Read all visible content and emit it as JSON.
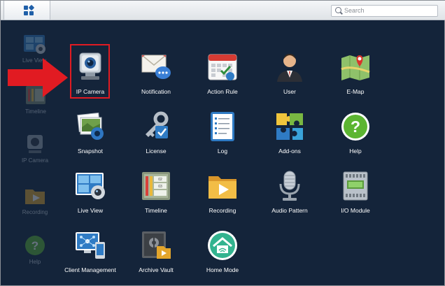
{
  "topbar": {
    "menu_icon": "grid-icon",
    "search": {
      "placeholder": "Search",
      "icon": "search-icon"
    }
  },
  "desktop": {
    "items": [
      {
        "label": "Live View",
        "icon": "live-view-icon"
      },
      {
        "label": "Timeline",
        "icon": "timeline-icon"
      },
      {
        "label": "IP Camera",
        "icon": "ip-camera-icon"
      },
      {
        "label": "Recording",
        "icon": "recording-icon"
      },
      {
        "label": "Help",
        "icon": "help-icon"
      }
    ]
  },
  "apps": [
    {
      "label": "IP Camera",
      "icon": "ip-camera-icon"
    },
    {
      "label": "Notification",
      "icon": "notification-icon"
    },
    {
      "label": "Action Rule",
      "icon": "action-rule-icon"
    },
    {
      "label": "User",
      "icon": "user-icon"
    },
    {
      "label": "E-Map",
      "icon": "e-map-icon"
    },
    {
      "label": "Snapshot",
      "icon": "snapshot-icon"
    },
    {
      "label": "License",
      "icon": "license-icon"
    },
    {
      "label": "Log",
      "icon": "log-icon"
    },
    {
      "label": "Add-ons",
      "icon": "add-ons-icon"
    },
    {
      "label": "Help",
      "icon": "help-icon"
    },
    {
      "label": "Live View",
      "icon": "live-view-icon"
    },
    {
      "label": "Timeline",
      "icon": "timeline-icon"
    },
    {
      "label": "Recording",
      "icon": "recording-icon"
    },
    {
      "label": "Audio Pattern",
      "icon": "audio-pattern-icon"
    },
    {
      "label": "I/O Module",
      "icon": "io-module-icon"
    },
    {
      "label": "Client Management",
      "icon": "client-management-icon"
    },
    {
      "label": "Archive Vault",
      "icon": "archive-vault-icon"
    },
    {
      "label": "Home Mode",
      "icon": "home-mode-icon"
    }
  ],
  "annotation": {
    "highlight_color": "#e11b22",
    "arrow_color": "#e11b22"
  },
  "colors": {
    "background": "#14243a",
    "accent": "#1f5fa8"
  }
}
